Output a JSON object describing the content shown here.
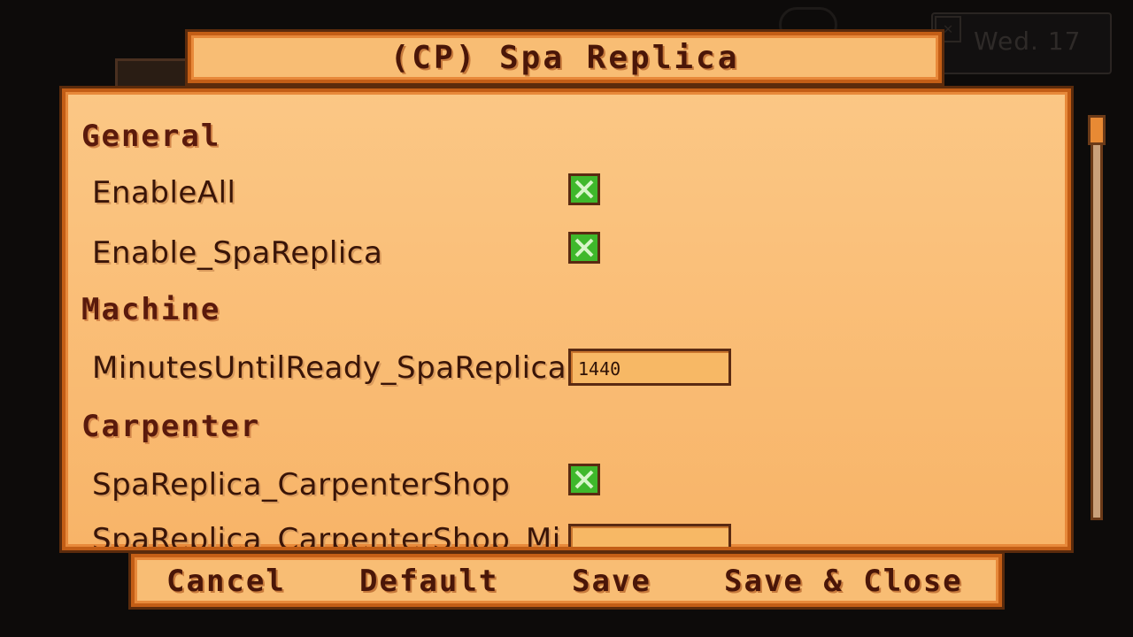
{
  "background": {
    "date_text": "Wed. 17"
  },
  "title": "(CP) Spa Replica",
  "sections": [
    {
      "header": "General",
      "options": [
        {
          "label": "EnableAll",
          "type": "checkbox",
          "checked": true
        },
        {
          "label": "Enable_SpaReplica",
          "type": "checkbox",
          "checked": true
        }
      ]
    },
    {
      "header": "Machine",
      "options": [
        {
          "label": "MinutesUntilReady_SpaReplica",
          "type": "text",
          "value": "1440"
        }
      ]
    },
    {
      "header": "Carpenter",
      "options": [
        {
          "label": "SpaReplica_CarpenterShop",
          "type": "checkbox",
          "checked": true
        },
        {
          "label": "SpaReplica_CarpenterShop_Mi",
          "type": "text",
          "value": ""
        }
      ]
    }
  ],
  "buttons": {
    "cancel": "Cancel",
    "default": "Default",
    "save": "Save",
    "save_close": "Save & Close"
  },
  "colors": {
    "panel": "#f8bd74",
    "border": "#c35e16",
    "text": "#3a1508",
    "checkbox_fill": "#3fb82b"
  }
}
